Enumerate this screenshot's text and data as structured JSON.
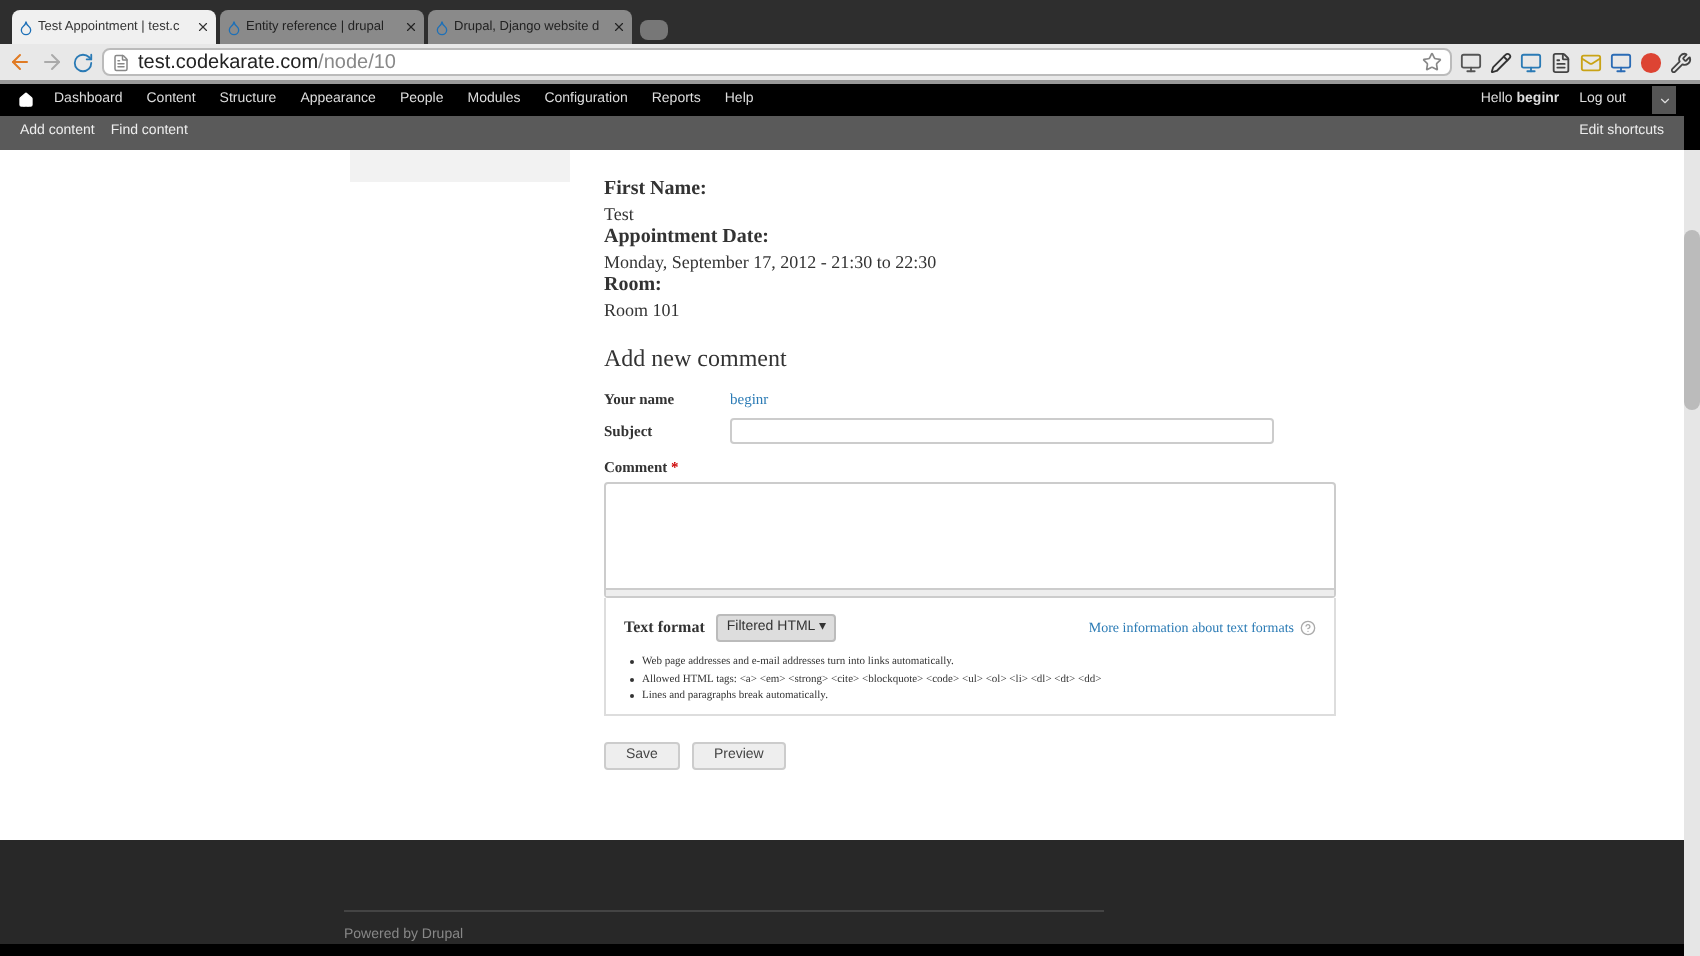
{
  "browser": {
    "tabs": [
      {
        "title": "Test Appointment | test.c",
        "selected": true
      },
      {
        "title": "Entity reference | drupal",
        "selected": false
      },
      {
        "title": "Drupal, Django website d",
        "selected": false
      }
    ],
    "address": {
      "host": "test.codekarate.com",
      "path": "/node/10"
    }
  },
  "toolbar": {
    "items": [
      "Dashboard",
      "Content",
      "Structure",
      "Appearance",
      "People",
      "Modules",
      "Configuration",
      "Reports",
      "Help"
    ],
    "greeting": "Hello",
    "user": "beginr",
    "logout": "Log out"
  },
  "shortcuts": {
    "items": [
      "Add content",
      "Find content"
    ],
    "edit": "Edit shortcuts"
  },
  "node": {
    "fields": [
      {
        "label": "First Name:",
        "value": "Test"
      },
      {
        "label": "Appointment Date:",
        "value": "Monday, September 17, 2012 - 21:30 to 22:30"
      },
      {
        "label": "Room:",
        "value": "Room 101"
      }
    ]
  },
  "comment_form": {
    "title": "Add new comment",
    "name_label": "Your name",
    "name_value": "beginr",
    "subject_label": "Subject",
    "comment_label": "Comment",
    "required_mark": "*",
    "text_format_label": "Text format",
    "text_format_value": "Filtered HTML",
    "dropdown_arrow": "▾",
    "more_info": "More information about text formats",
    "tips": [
      "Web page addresses and e-mail addresses turn into links automatically.",
      "Allowed HTML tags: <a> <em> <strong> <cite> <blockquote> <code> <ul> <ol> <li> <dl> <dt> <dd>",
      "Lines and paragraphs break automatically."
    ],
    "buttons": [
      "Save",
      "Preview"
    ]
  },
  "footer": {
    "text": "Powered by Drupal"
  }
}
